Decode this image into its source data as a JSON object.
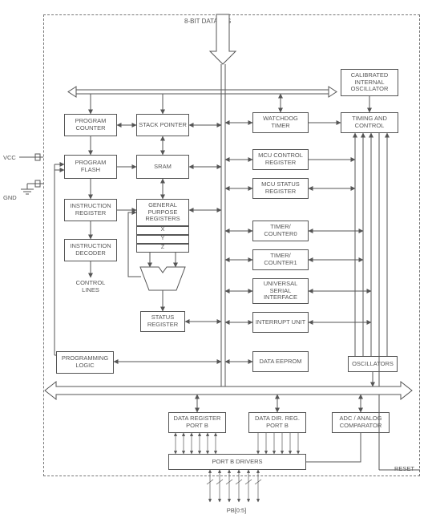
{
  "title": "8-BIT DATABUS",
  "pins": {
    "vcc": "VCC",
    "gnd": "GND",
    "reset": "RESET",
    "portb": "PB[0:5]"
  },
  "blocks": {
    "prog_counter": "PROGRAM COUNTER",
    "stack_ptr": "STACK POINTER",
    "prog_flash": "PROGRAM FLASH",
    "sram": "SRAM",
    "instr_reg": "INSTRUCTION REGISTER",
    "gpr": "GENERAL PURPOSE REGISTERS",
    "gpr_x": "X",
    "gpr_y": "Y",
    "gpr_z": "Z",
    "instr_dec": "INSTRUCTION DECODER",
    "ctrl_lines": "CONTROL LINES",
    "alu": "ALU",
    "status_reg": "STATUS REGISTER",
    "prog_logic": "PROGRAMMING LOGIC",
    "wdt": "WATCHDOG TIMER",
    "mcu_ctrl": "MCU CONTROL REGISTER",
    "mcu_stat": "MCU STATUS REGISTER",
    "tc0": "TIMER/ COUNTER0",
    "tc1": "TIMER/ COUNTER1",
    "usi": "UNIVERSAL SERIAL INTERFACE",
    "int_unit": "INTERRUPT UNIT",
    "data_eeprom": "DATA EEPROM",
    "cal_osc": "CALIBRATED INTERNAL OSCILLATOR",
    "timing": "TIMING AND CONTROL",
    "osc": "OSCILLATORS",
    "data_reg_b": "DATA REGISTER PORT B",
    "data_dir_b": "DATA DIR. REG. PORT B",
    "adc": "ADC / ANALOG COMPARATOR",
    "portb_drv": "PORT B DRIVERS"
  }
}
